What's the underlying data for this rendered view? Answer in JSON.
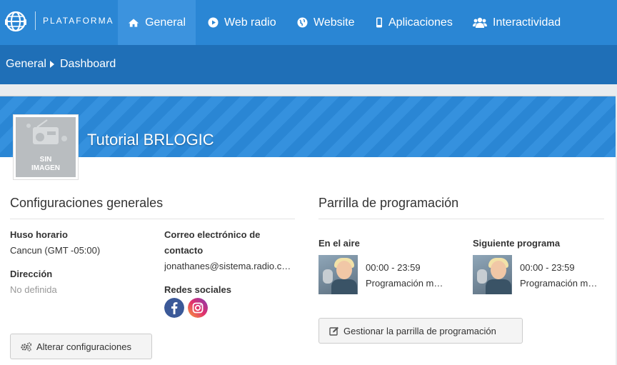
{
  "brand": {
    "name": "PLATAFORMA"
  },
  "nav": {
    "tabs": [
      {
        "label": "General",
        "icon": "home-icon",
        "active": true
      },
      {
        "label": "Web radio",
        "icon": "play-circle-icon"
      },
      {
        "label": "Website",
        "icon": "globe-icon"
      },
      {
        "label": "Aplicaciones",
        "icon": "mobile-icon"
      },
      {
        "label": "Interactividad",
        "icon": "users-icon"
      }
    ]
  },
  "breadcrumb": {
    "items": [
      "General",
      "Dashboard"
    ]
  },
  "station": {
    "name": "Tutorial BRLOGIC",
    "image_line1": "SIN",
    "image_line2": "IMAGEN"
  },
  "general": {
    "title": "Configuraciones generales",
    "timezone_label": "Huso horario",
    "timezone_value": "Cancun (GMT -05:00)",
    "address_label": "Dirección",
    "address_value": "No definida",
    "email_label_1": "Correo electrónico de",
    "email_label_2": "contacto",
    "email_value": "jonathanes@sistema.radio.com",
    "social_label": "Redes sociales",
    "edit_button": "Alterar configuraciones"
  },
  "schedule": {
    "title": "Parrilla de programación",
    "on_air_label": "En el aire",
    "on_air_time": "00:00 - 23:59",
    "on_air_program": "Programación musical",
    "next_label": "Siguiente programa",
    "next_time": "00:00 - 23:59",
    "next_program": "Programación musical",
    "manage_button": "Gestionar la parrilla de programación"
  },
  "colors": {
    "nav": "#2a86d4",
    "nav_active": "#3c93de",
    "crumb": "#1f6fb7",
    "facebook": "#3b5998",
    "instagram": "#c13584"
  }
}
